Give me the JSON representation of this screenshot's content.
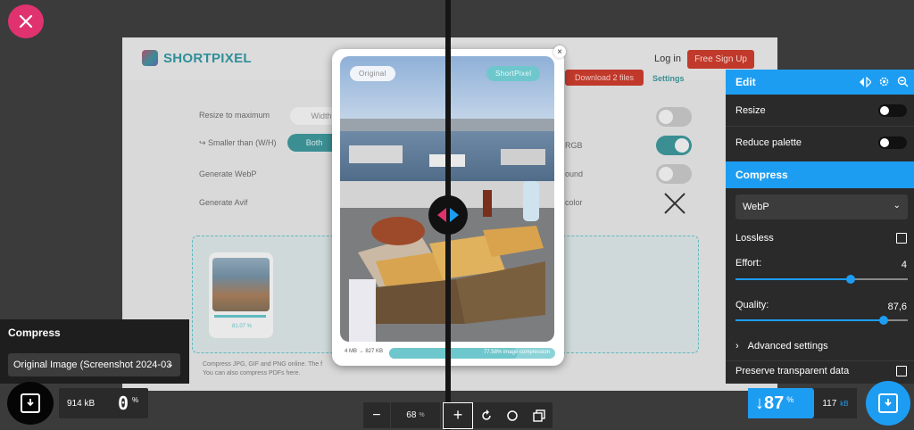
{
  "site": {
    "brand": "SHORTPIXEL",
    "login": "Log in",
    "signup": "Free Sign Up",
    "rows": [
      "Resize to maximum",
      "↪ Smaller than (W/H)",
      "Generate WebP",
      "Generate Avif"
    ],
    "width_label": "Width",
    "both_label": "Both",
    "download_label": "Download 2 files",
    "settings_label": "Settings",
    "right_labels": [
      "RGB",
      "ound",
      "color"
    ],
    "thumb_pct": "81.07 %",
    "footer_line1": "Compress JPG, GIF and PNG online. The f",
    "footer_line2": "You can also compress PDFs here."
  },
  "compare": {
    "original_tag": "Original",
    "shortpixel_tag": "ShortPixel",
    "size_change": "4 MB → 827 KB",
    "compression_label": "77.58% image compression",
    "compression_fraction": 0.7758
  },
  "edit_panel": {
    "title": "Edit",
    "resize_label": "Resize",
    "reduce_palette_label": "Reduce palette",
    "compress_title": "Compress",
    "format": "WebP",
    "lossless_label": "Lossless",
    "effort_label": "Effort:",
    "effort_value": "4",
    "effort_fraction": 0.67,
    "quality_label": "Quality:",
    "quality_value": "87,6",
    "quality_fraction": 0.86,
    "advanced_label": "Advanced settings",
    "preserve_label": "Preserve transparent data"
  },
  "left_panel": {
    "title": "Compress",
    "select_value": "Original Image (Screenshot 2024-03"
  },
  "bottom": {
    "original_size": "914",
    "original_unit": "kB",
    "original_pct": "0",
    "pct_symbol": "%",
    "zoom_value": "68",
    "zoom_unit": "%",
    "result_pct": "↓87",
    "result_size": "117",
    "result_unit": "kB"
  },
  "colors": {
    "accent": "#1d9df2",
    "close": "#e0326f",
    "teal": "#6ec7cc"
  }
}
